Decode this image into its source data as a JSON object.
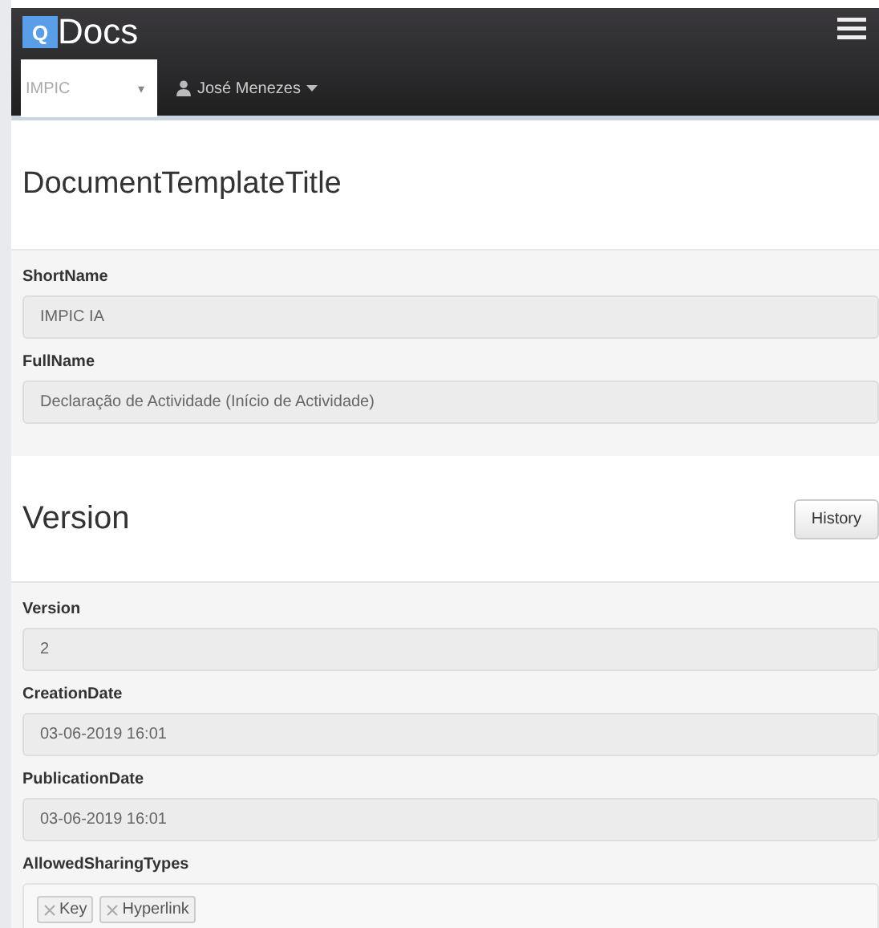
{
  "navbar": {
    "logo_mark": "Q",
    "logo_text": "Docs",
    "org_select": {
      "value": "IMPIC",
      "caret": "▾"
    },
    "user": {
      "name": "José Menezes"
    }
  },
  "sections": [
    {
      "title": "DocumentTemplateTitle",
      "fields": [
        {
          "kind": "text",
          "label": "ShortName",
          "value": "IMPIC IA"
        },
        {
          "kind": "text",
          "label": "FullName",
          "value": "Declaração de Actividade (Início de Actividade)"
        }
      ]
    },
    {
      "title": "Version",
      "button": "History",
      "fields": [
        {
          "kind": "text",
          "label": "Version",
          "value": "2"
        },
        {
          "kind": "text",
          "label": "CreationDate",
          "value": "03-06-2019 16:01"
        },
        {
          "kind": "text",
          "label": "PublicationDate",
          "value": "03-06-2019 16:01"
        },
        {
          "kind": "tags",
          "label": "AllowedSharingTypes",
          "tags": [
            "Key",
            "Hyperlink"
          ]
        }
      ]
    }
  ]
}
